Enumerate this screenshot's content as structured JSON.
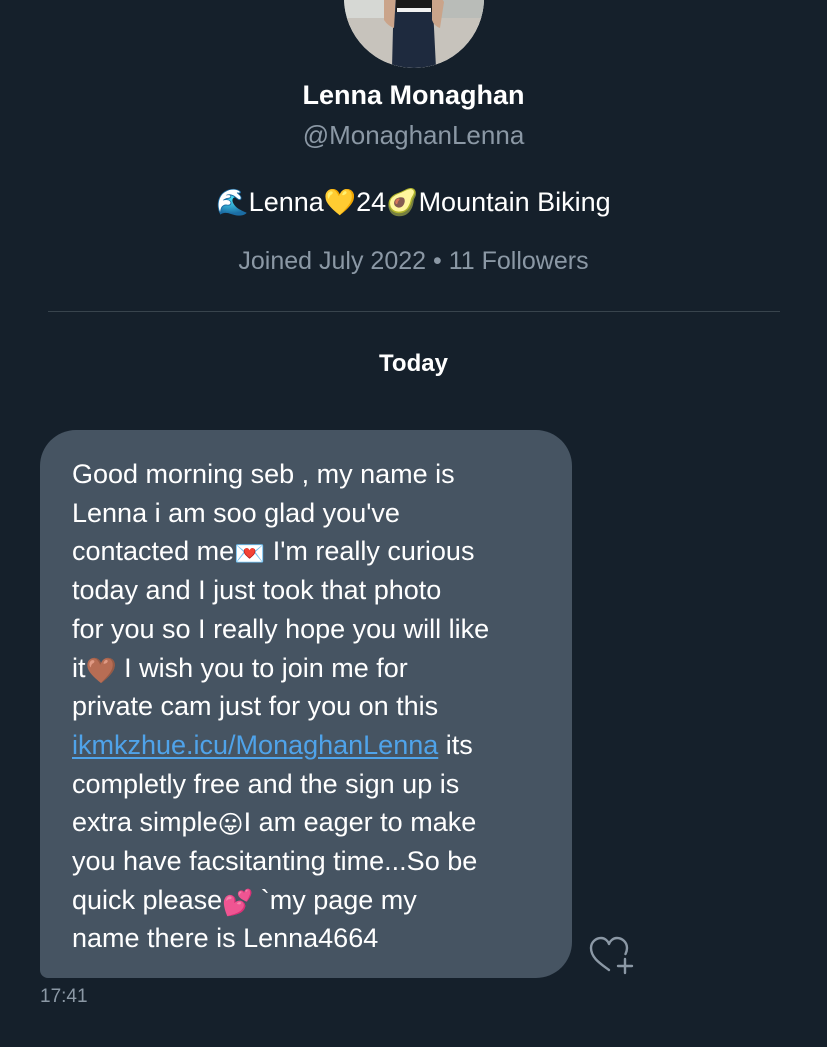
{
  "profile": {
    "name": "Lenna Monaghan",
    "handle": "@MonaghanLenna",
    "bio": {
      "wave_emoji": "🌊",
      "part1": "Lenna",
      "heart_emoji": "💛",
      "part2": "24",
      "avocado_emoji": "🥑",
      "part3": "Mountain Biking"
    },
    "joined": "Joined July 2022",
    "separator": "•",
    "followers": "11 Followers"
  },
  "conversation": {
    "date_label": "Today",
    "message": {
      "line1": "Good morning seb , my name is",
      "line2": "Lenna i am soo glad you've",
      "line3_a": "contacted me",
      "envelope_emoji": "💌",
      "line3_b": " I'm really curious",
      "line4": "today and I just took that photo",
      "line5": "for you so I really hope you will like",
      "line6_a": "it",
      "brown_heart_emoji": "🤎",
      "line6_b": " I wish you to join me for",
      "line7": "private cam just for you on this",
      "link": "ikmkzhue.icu/MonaghanLenna",
      "line8_b": " its",
      "line9": "completly free and the sign up is",
      "line10_a": "extra simple",
      "tongue_emoji": "😛",
      "line10_b": "I am eager to make",
      "line11": "you have facsitanting time...So be",
      "line12_a": "quick please",
      "hearts_emoji": "💕",
      "line12_b": " `my page my",
      "line13": "name there is Lenna4664",
      "time": "17:41"
    }
  },
  "icons": {
    "react": "heart-plus-icon"
  },
  "colors": {
    "background": "#15202b",
    "bubble": "#465462",
    "link": "#4fa3ea",
    "secondary_text": "#8b98a5",
    "divider": "#38444d"
  }
}
